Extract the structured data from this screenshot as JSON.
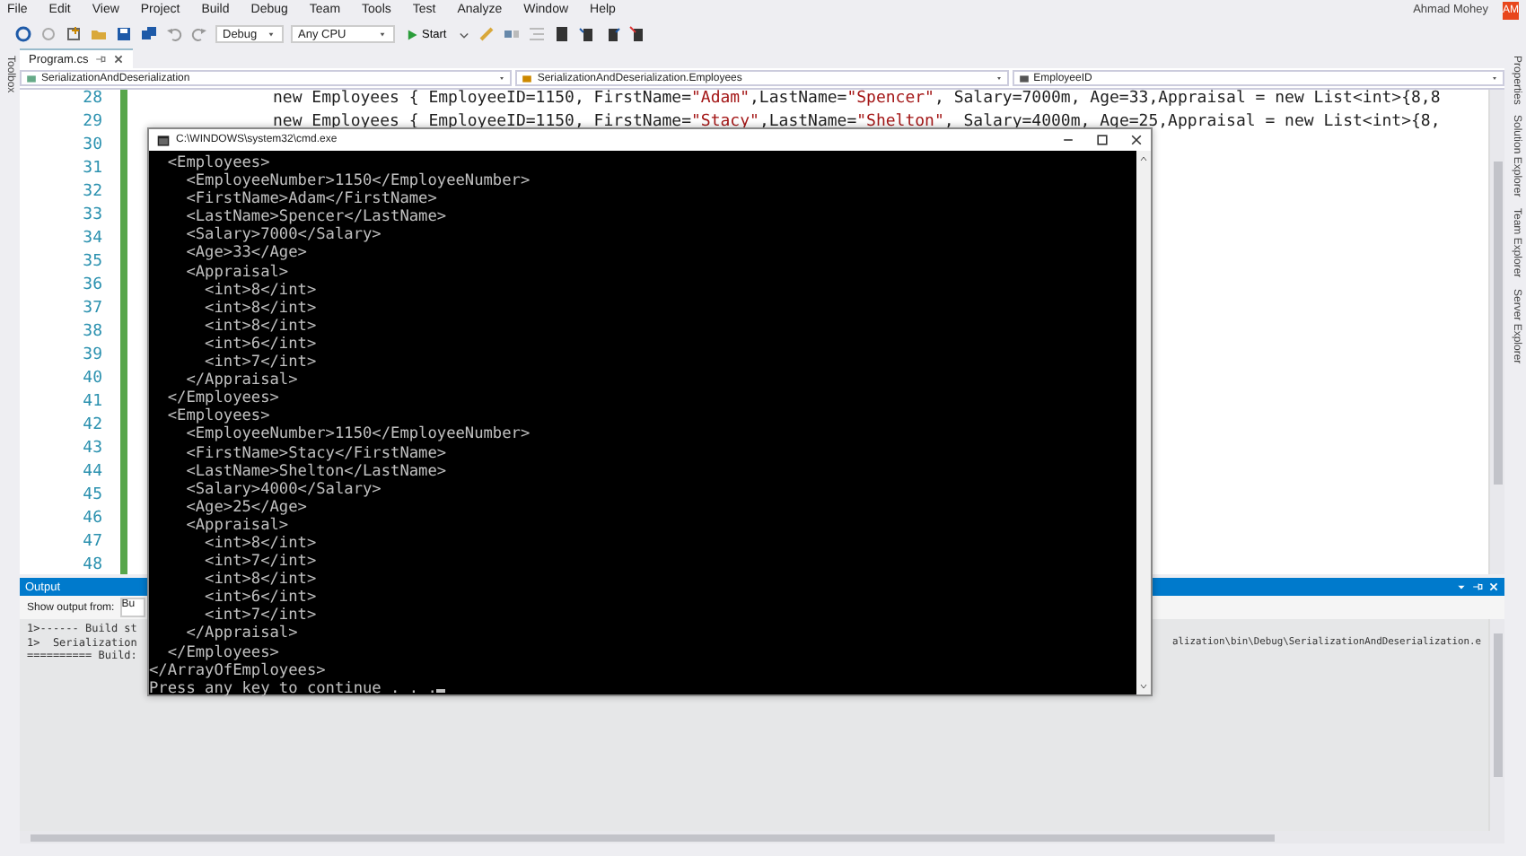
{
  "menu": [
    "File",
    "Edit",
    "View",
    "Project",
    "Build",
    "Debug",
    "Team",
    "Tools",
    "Test",
    "Analyze",
    "Window",
    "Help"
  ],
  "account": {
    "name": "Ahmad Mohey",
    "initials": "AM"
  },
  "toolbar": {
    "configuration": "Debug",
    "platform": "Any CPU",
    "start": "Start"
  },
  "left_rail": [
    "Toolbox"
  ],
  "right_rail": [
    "Properties",
    "Solution Explorer",
    "Team Explorer",
    "Server Explorer"
  ],
  "document_tabs": [
    {
      "label": "Program.cs",
      "selected": true
    }
  ],
  "navigation_bar": [
    "SerializationAndDeserialization",
    "SerializationAndDeserialization.Employees",
    "EmployeeID"
  ],
  "editor": {
    "lines": [
      {
        "number": "28",
        "code": "new Employees { EmployeeID=1150, FirstName=\"Adam\",LastName=\"Spencer\", Salary=7000m, Age=33,Appraisal = new List<int>{8,8"
      },
      {
        "number": "29",
        "code": "new Employees { EmployeeID=1150, FirstName=\"Stacy\",LastName=\"Shelton\", Salary=4000m, Age=25,Appraisal = new List<int>{8,"
      },
      {
        "number": "30"
      },
      {
        "number": "31"
      },
      {
        "number": "32"
      },
      {
        "number": "33"
      },
      {
        "number": "34"
      },
      {
        "number": "35"
      },
      {
        "number": "36"
      },
      {
        "number": "37"
      },
      {
        "number": "38"
      },
      {
        "number": "39"
      },
      {
        "number": "40"
      },
      {
        "number": "41"
      },
      {
        "number": "42"
      },
      {
        "number": "43"
      },
      {
        "number": "44"
      },
      {
        "number": "45"
      },
      {
        "number": "46"
      },
      {
        "number": "47"
      },
      {
        "number": "48"
      }
    ]
  },
  "output_panel": {
    "title": "Output",
    "show_output_from": "Show output from:",
    "source": "Bu",
    "lines": [
      {
        "text": "1>------ Build st"
      },
      {
        "text": "1>  Serialization",
        "tail": "alization\\bin\\Debug\\SerializationAndDeserialization.e"
      },
      {
        "text": "========== Build:"
      }
    ]
  },
  "console_window": {
    "title": "C:\\WINDOWS\\system32\\cmd.exe",
    "lines": [
      "  <Employees>",
      "    <EmployeeNumber>1150</EmployeeNumber>",
      "    <FirstName>Adam</FirstName>",
      "    <LastName>Spencer</LastName>",
      "    <Salary>7000</Salary>",
      "    <Age>33</Age>",
      "    <Appraisal>",
      "      <int>8</int>",
      "      <int>8</int>",
      "      <int>8</int>",
      "      <int>6</int>",
      "      <int>7</int>",
      "    </Appraisal>",
      "  </Employees>",
      "  <Employees>",
      "    <EmployeeNumber>1150</EmployeeNumber>",
      "    <FirstName>Stacy</FirstName>",
      "    <LastName>Shelton</LastName>",
      "    <Salary>4000</Salary>",
      "    <Age>25</Age>",
      "    <Appraisal>",
      "      <int>8</int>",
      "      <int>7</int>",
      "      <int>8</int>",
      "      <int>6</int>",
      "      <int>7</int>",
      "    </Appraisal>",
      "  </Employees>",
      "</ArrayOfEmployees>",
      "Press any key to continue . . ."
    ]
  }
}
